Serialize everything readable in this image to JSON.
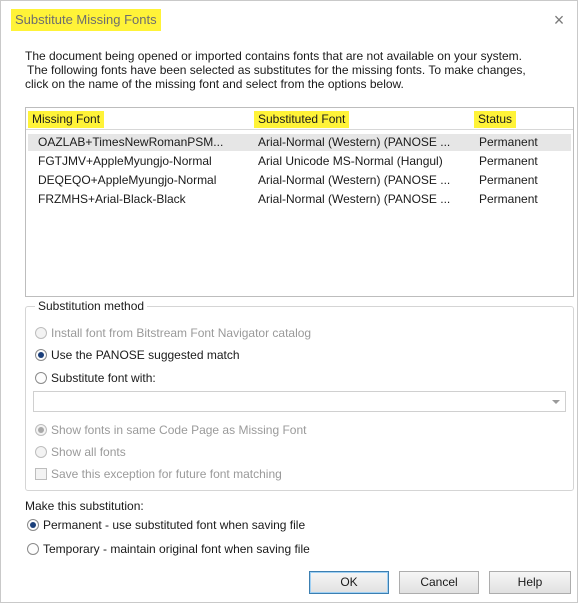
{
  "dialog": {
    "title": "Substitute Missing Fonts",
    "close_glyph": "×",
    "highlight_color": "#fff338"
  },
  "description": {
    "line1": "The document being opened or imported contains fonts that are not available on your system.",
    "line2": "The following fonts have been selected as substitutes for the missing fonts.  To make changes,",
    "line3": "click on the name of the missing font and select from the options below."
  },
  "table": {
    "headers": {
      "missing": "Missing Font",
      "substituted": "Substituted Font",
      "status": "Status"
    },
    "rows": [
      {
        "missing": "OAZLAB+TimesNewRomanPSM...",
        "substituted": "Arial-Normal (Western) (PANOSE ...",
        "status": "Permanent"
      },
      {
        "missing": "FGTJMV+AppleMyungjo-Normal",
        "substituted": "Arial Unicode MS-Normal (Hangul)",
        "status": "Permanent"
      },
      {
        "missing": "DEQEQO+AppleMyungjo-Normal",
        "substituted": "Arial-Normal (Western) (PANOSE ...",
        "status": "Permanent"
      },
      {
        "missing": "FRZMHS+Arial-Black-Black",
        "substituted": "Arial-Normal (Western) (PANOSE ...",
        "status": "Permanent"
      }
    ]
  },
  "substitution_method": {
    "legend": "Substitution method",
    "install_font": "Install font from Bitstream Font Navigator catalog",
    "use_panose": "Use the PANOSE suggested match",
    "substitute_with": "Substitute font with:",
    "font_select_value": "",
    "show_same_code_page": "Show fonts in same Code Page as Missing Font",
    "show_all": "Show all fonts",
    "save_exception": "Save this exception for future font matching"
  },
  "make_substitution": {
    "label": "Make this substitution:",
    "permanent": "Permanent - use substituted font when saving file",
    "temporary": "Temporary - maintain original font when saving file"
  },
  "buttons": {
    "ok": "OK",
    "cancel": "Cancel",
    "help": "Help"
  }
}
